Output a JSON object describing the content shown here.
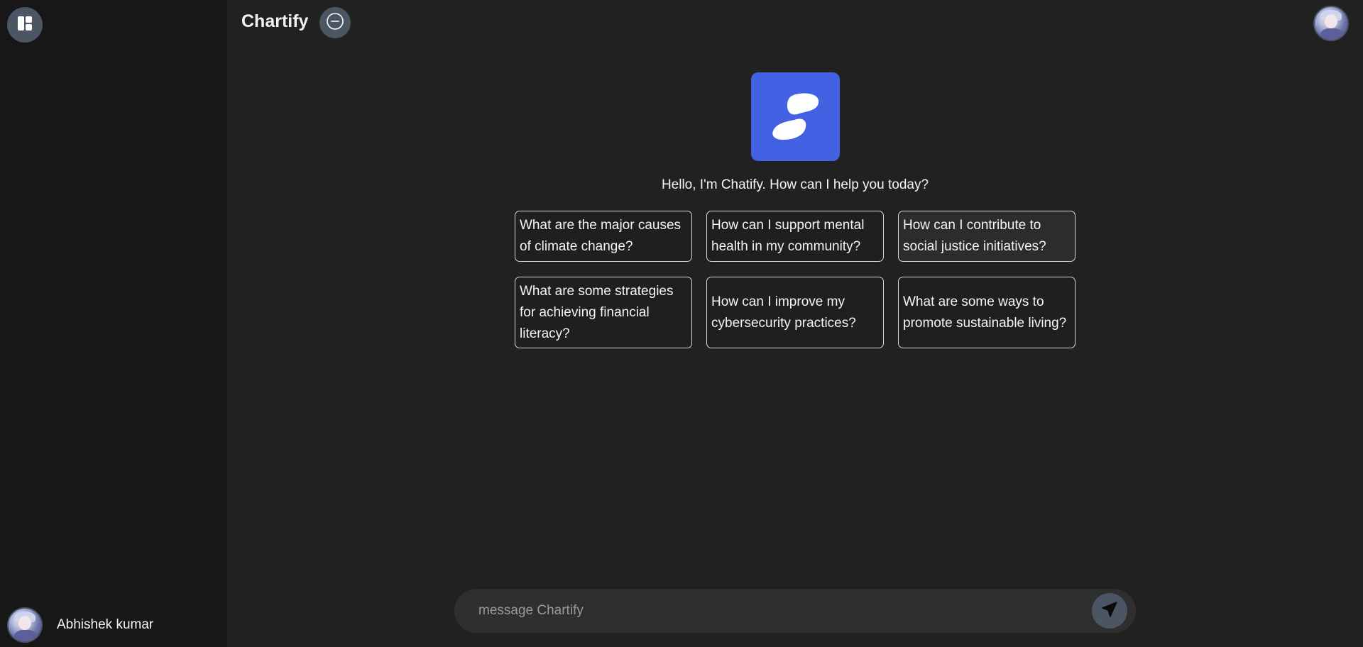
{
  "header": {
    "title": "Chartify"
  },
  "sidebar": {
    "toggle_icon": "sidebar-layout-icon",
    "user": {
      "name": "Abhishek kumar",
      "avatar": "avatar"
    }
  },
  "main": {
    "logo_icon": "chatify-logo-icon",
    "greeting": "Hello, I'm Chatify. How can I help you today?",
    "suggestions": [
      "What are the major causes of climate change?",
      "How can I support mental health in my community?",
      "How can I contribute to social justice initiatives?",
      "What are some strategies for achieving financial literacy?",
      "How can I improve my cybersecurity practices?",
      "What are some ways to promote sustainable living?"
    ]
  },
  "composer": {
    "placeholder": "message Chartify",
    "value": "",
    "send_icon": "send-icon"
  },
  "colors": {
    "background": "#212121",
    "sidebar": "#171717",
    "button": "#4b5563",
    "brand": "#4361e3",
    "composer": "#2f2f2f"
  }
}
